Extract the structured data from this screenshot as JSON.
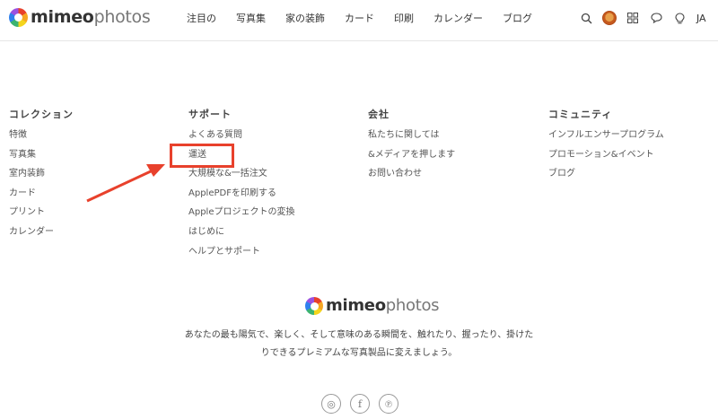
{
  "brand": {
    "name_bold": "mimeo",
    "name_light": "photos"
  },
  "nav": [
    "注目の",
    "写真集",
    "家の装飾",
    "カード",
    "印刷",
    "カレンダー",
    "ブログ"
  ],
  "header_right": {
    "language": "JA"
  },
  "columns": [
    {
      "title": "コレクション",
      "links": [
        "特徴",
        "写真集",
        "室内装飾",
        "カード",
        "プリント",
        "カレンダー"
      ]
    },
    {
      "title": "サポート",
      "links": [
        "よくある質問",
        "運送",
        "大規模な&一括注文",
        "ApplePDFを印刷する",
        "Appleプロジェクトの変換",
        "はじめに",
        "ヘルプとサポート"
      ]
    },
    {
      "title": "会社",
      "links": [
        "私たちに関しては",
        "&メディアを押します",
        "お問い合わせ"
      ]
    },
    {
      "title": "コミュニティ",
      "links": [
        "インフルエンサープログラム",
        "プロモーション&イベント",
        "ブログ"
      ]
    }
  ],
  "tagline": {
    "line1": "あなたの最も陽気で、楽しく、そして意味のある瞬間を、触れたり、握ったり、掛けた",
    "line2": "りできるプレミアムな写真製品に変えましょう。"
  },
  "annotation": {
    "color": "#e8412c",
    "highlighted": "運送"
  },
  "social_icons": [
    "instagram-icon",
    "facebook-icon",
    "pinterest-icon"
  ],
  "social_glyphs": [
    "◎",
    "f",
    "℗"
  ]
}
